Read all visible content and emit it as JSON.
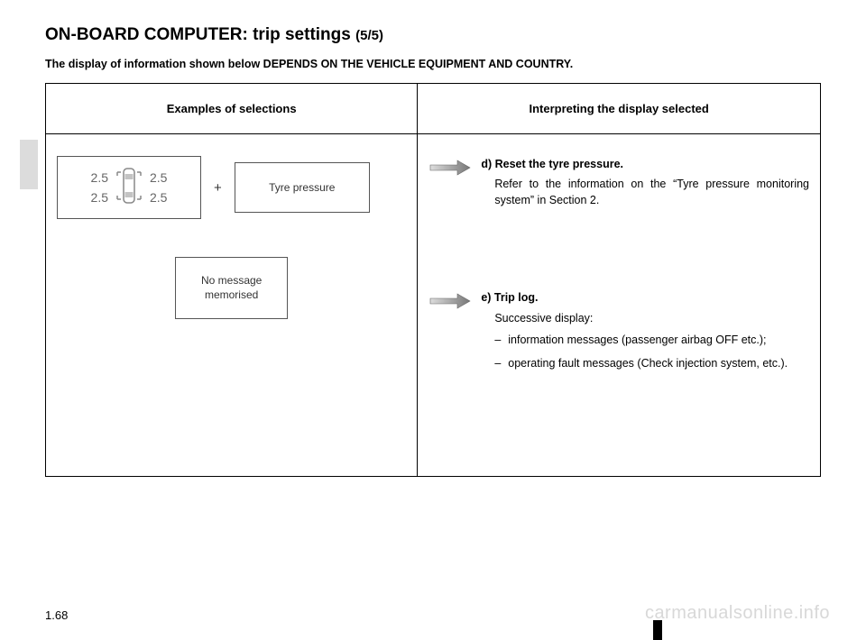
{
  "title_main": "ON-BOARD COMPUTER: trip settings ",
  "title_sub": "(5/5)",
  "subtitle": "The display of information shown below DEPENDS ON THE VEHICLE EQUIPMENT AND COUNTRY.",
  "table": {
    "header_left": "Examples of selections",
    "header_right": "Interpreting the display selected"
  },
  "left": {
    "tyre_values": [
      "2.5",
      "2.5",
      "2.5",
      "2.5"
    ],
    "plus": "+",
    "tyre_label": "Tyre pressure",
    "no_msg_line1": "No message",
    "no_msg_line2": "memorised"
  },
  "right": {
    "d_head": "d) Reset the tyre pressure.",
    "d_body": "Refer to the information on the “Tyre pressure monitoring system” in Section 2.",
    "e_head": "e) Trip log.",
    "e_sub": "Successive display:",
    "e_bullet1": "information messages (passenger airbag OFF etc.);",
    "e_bullet2": "operating fault messages (Check injection system, etc.)."
  },
  "page_num": "1.68",
  "watermark": "carmanualsonline.info"
}
